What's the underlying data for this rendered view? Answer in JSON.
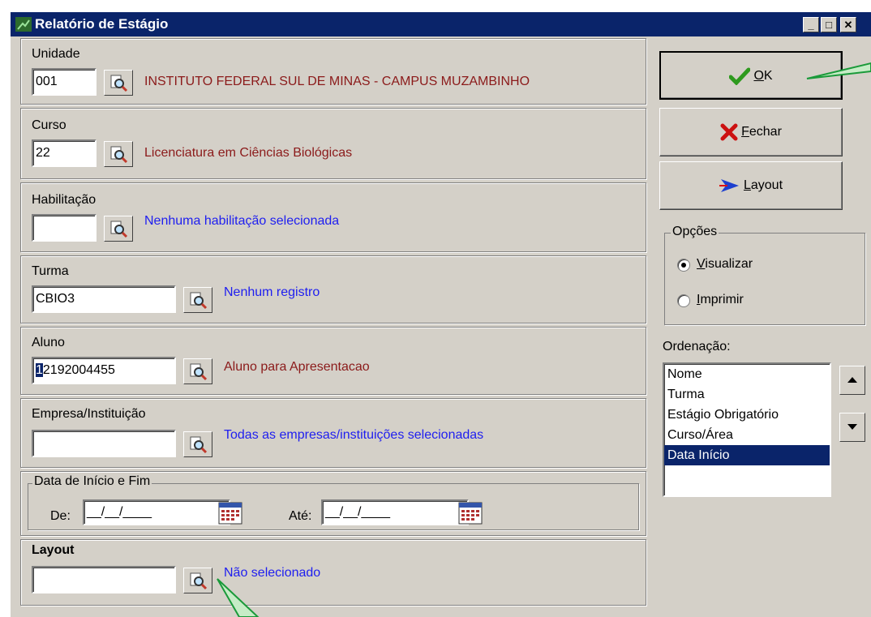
{
  "window": {
    "title": "Relatório de Estágio",
    "minimize": "_",
    "maximize": "□",
    "close": "✕"
  },
  "unidade": {
    "label": "Unidade",
    "value": "001",
    "description": "INSTITUTO FEDERAL SUL DE MINAS - CAMPUS MUZAMBINHO"
  },
  "curso": {
    "label": "Curso",
    "value": "22",
    "description": "Licenciatura em Ciências Biológicas"
  },
  "habilitacao": {
    "label": "Habilitação",
    "value": "",
    "description": "Nenhuma habilitação selecionada"
  },
  "turma": {
    "label": "Turma",
    "value": "CBIO3",
    "description": "Nenhum registro"
  },
  "aluno": {
    "label": "Aluno",
    "value_first": "1",
    "value_rest": "2192004455",
    "description": "Aluno para Apresentacao"
  },
  "empresa": {
    "label": "Empresa/Instituição",
    "value": "",
    "description": "Todas as empresas/instituições selecionadas"
  },
  "datas": {
    "legend": "Data de Início e Fim",
    "de_label": "De:",
    "de_value": "__/__/____",
    "ate_label": "Até:",
    "ate_value": "__/__/____"
  },
  "layout_field": {
    "label": "Layout",
    "value": "",
    "description": "Não selecionado"
  },
  "buttons": {
    "ok_key": "O",
    "ok_rest": "K",
    "fechar_key": "F",
    "fechar_rest": "echar",
    "layout_key": "L",
    "layout_rest": "ayout"
  },
  "opcoes": {
    "legend": "Opções",
    "visualizar_key": "V",
    "visualizar_rest": "isualizar",
    "visualizar_selected": true,
    "imprimir_key": "I",
    "imprimir_rest": "mprimir",
    "imprimir_selected": false
  },
  "ordenacao": {
    "label": "Ordenação:",
    "items": [
      "Nome",
      "Turma",
      "Estágio Obrigatório",
      "Curso/Área",
      "Data Início"
    ],
    "selected": "Data Início"
  },
  "colors": {
    "title_bar": "#0a246a",
    "window_bg": "#d4d0c8",
    "red_text": "#8b1a1a",
    "blue_text": "#1e1ef0",
    "annotation": "#1a9a3a"
  }
}
